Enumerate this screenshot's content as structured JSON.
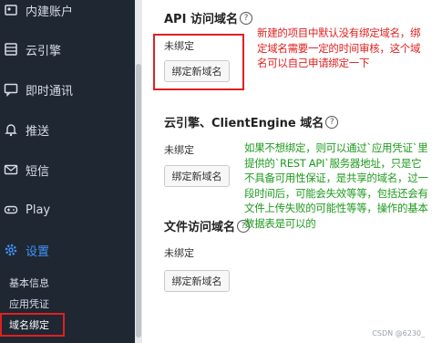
{
  "sidebar": {
    "items": [
      {
        "label": "内建账户",
        "icon": "users-icon"
      },
      {
        "label": "云引擎",
        "icon": "server-icon"
      },
      {
        "label": "即时通讯",
        "icon": "chat-icon"
      },
      {
        "label": "推送",
        "icon": "bell-icon"
      },
      {
        "label": "短信",
        "icon": "mail-icon"
      },
      {
        "label": "Play",
        "icon": "gamepad-icon"
      },
      {
        "label": "设置",
        "icon": "gear-icon"
      }
    ],
    "sub_items": [
      "基本信息",
      "应用凭证",
      "域名绑定"
    ],
    "active_color": "#3f94f7"
  },
  "sections": [
    {
      "title": "API 访问域名",
      "status": "未绑定",
      "button": "绑定新域名"
    },
    {
      "title": "云引擎、ClientEngine 域名",
      "status": "未绑定",
      "button": "绑定新域名"
    },
    {
      "title": "文件访问域名",
      "status": "未绑定",
      "button": "绑定新域名"
    }
  ],
  "annotations": {
    "red_note": "新建的项目中默认没有绑定域名，绑定域名需要一定的时间审核，这个域名可以自己申请绑定一下",
    "green_note": "如果不想绑定，则可以通过`应用凭证`里提供的`REST API`服务器地址，只是它不具备可用性保证，是共享的域名，过一段时间后，可能会失效等等，包括还会有文件上传失败的可能性等等，操作的基本数据表是可以的",
    "red_color": "#e02020",
    "green_color": "#1f9a1f"
  },
  "watermark": "CSDN @6230_"
}
